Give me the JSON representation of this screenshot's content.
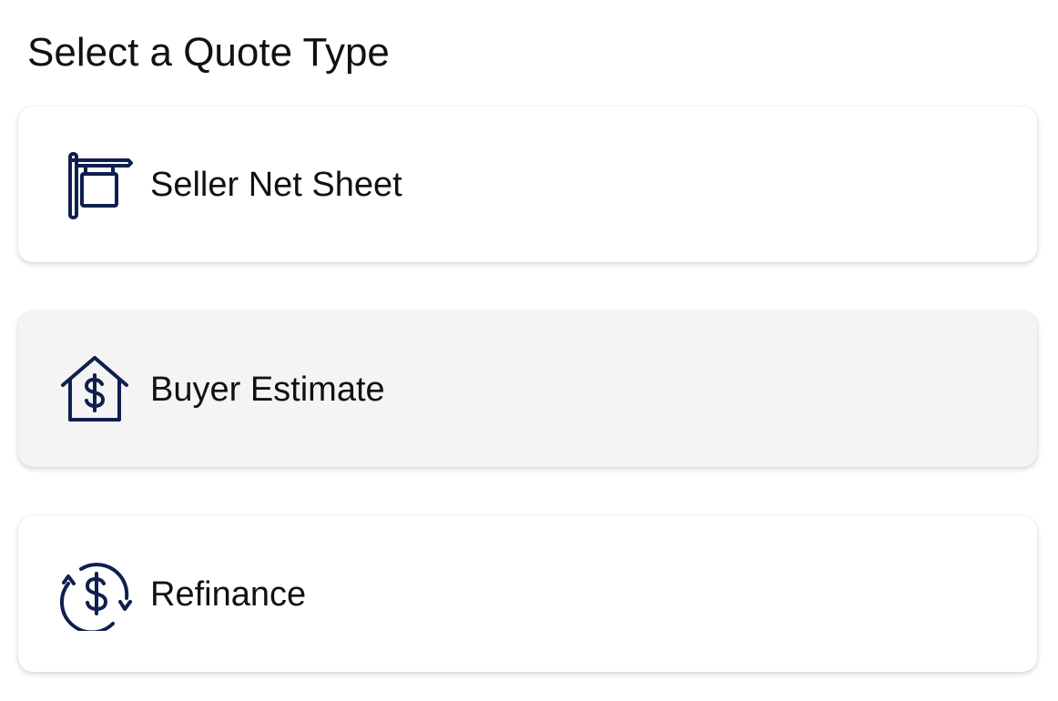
{
  "page": {
    "title": "Select a Quote Type"
  },
  "theme": {
    "icon_color": "#0f1f4f",
    "card_bg": "#ffffff",
    "card_highlight_bg": "#f4f4f4",
    "text_color": "#111111"
  },
  "quote_types": [
    {
      "label": "Seller Net Sheet",
      "icon": "for-sale-sign-icon",
      "highlighted": false
    },
    {
      "label": "Buyer Estimate",
      "icon": "house-dollar-icon",
      "highlighted": true
    },
    {
      "label": "Refinance",
      "icon": "refresh-dollar-icon",
      "highlighted": false
    }
  ]
}
